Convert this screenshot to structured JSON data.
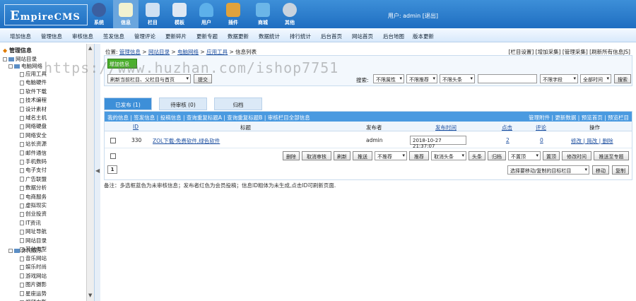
{
  "app": {
    "logo_main": "E",
    "logo_rest": "mpireCMS"
  },
  "topnav": [
    {
      "label": "系统",
      "icon": "system-icon",
      "color": "#3b5fa0"
    },
    {
      "label": "信息",
      "icon": "edit-icon",
      "color": "#f2f2d0"
    },
    {
      "label": "栏目",
      "icon": "column-icon",
      "color": "#cfe0f2"
    },
    {
      "label": "模板",
      "icon": "template-icon",
      "color": "#dfe8f3"
    },
    {
      "label": "用户",
      "icon": "user-icon",
      "color": "#5db0ea"
    },
    {
      "label": "插件",
      "icon": "plugin-icon",
      "color": "#e0a23c"
    },
    {
      "label": "商城",
      "icon": "shop-icon",
      "color": "#6bb6e8"
    },
    {
      "label": "其他",
      "icon": "gear-icon",
      "color": "#c9d3de"
    }
  ],
  "userinfo": "用户: admin  [退出]",
  "subnav": [
    "增加信息",
    "管理信息",
    "审核信息",
    "签发信息",
    "管理评论",
    "更新碎片",
    "更新专题",
    "数据更新",
    "数据统计",
    "排行统计",
    "后台首页",
    "网站首页",
    "后台地图",
    "版本更新"
  ],
  "sidebar": {
    "title": "管理信息",
    "root": "网站目录",
    "group1": "电脑网络",
    "group1_items": [
      "应用工具",
      "电脑硬件",
      "软件下载",
      "技术编程",
      "设计素材",
      "域名主机",
      "网络硬盘",
      "网络安全",
      "站长资源",
      "邮件通信",
      "手机数码",
      "电子支付",
      "广告联盟",
      "数据分析",
      "电商服务",
      "虚拟现实",
      "创业投资",
      "IT资讯",
      "网址导航",
      "网站目录",
      "其他类型"
    ],
    "group2": "休闲娱乐",
    "group2_items": [
      "音乐网站",
      "娱乐时尚",
      "游戏网站",
      "图片摄影",
      "星座运势",
      "视频电影"
    ]
  },
  "breadcrumb": {
    "prefix": "位置:",
    "items": [
      "管理信息",
      "网站目录",
      "电脑网络",
      "应用工具",
      "信息列表"
    ]
  },
  "toplinks": "[栏目设置] [增加采集] [管理采集] [刷新所有信息JS]",
  "panel": {
    "batch_button": "增加信息",
    "refresh_select": "刷新当前栏目、父栏目与首页",
    "submit": "提交",
    "search_label": "搜索:",
    "filter1": "不限属性",
    "filter2": "不限推荐",
    "filter3": "不限头条",
    "field_select": "不限字段",
    "time_select": "全部时间",
    "search_button": "搜索"
  },
  "tabs": [
    "已发布 (1)",
    "待审核 (0)",
    "归档"
  ],
  "list_subnav_left": "我的信息 | 签发信息 | 投稿信息 | 查询重复标题A | 查询重复标题B | 审核栏目全部信息",
  "list_subnav_right": "管理附件 | 更新数据 | 预览首页 | 预览栏目",
  "columns": {
    "id": "ID",
    "title": "标题",
    "publisher": "发布者",
    "time": "发布时间",
    "clicks": "点击",
    "comments": "评论",
    "ops": "操作"
  },
  "rows": [
    {
      "id": "330",
      "title": "ZOL下载-免费软件,绿色软件",
      "publisher": "admin",
      "time": "2018-10-27 21:37:07",
      "clicks": "2",
      "comments": "0",
      "ops": "修改 | 简改 | 删除"
    }
  ],
  "actions": [
    "删除",
    "取消审核",
    "刷新",
    "推送",
    "不推荐",
    "推荐",
    "取消头条",
    "头条",
    "归档",
    "不置顶",
    "置顶",
    "修改时间",
    "推送至专题"
  ],
  "pager": {
    "page": "1",
    "move_select": "选择要移动/复制的目标栏目",
    "move": "移动",
    "copy": "复制"
  },
  "note": "备注：多选框蓝色为未审核信息；发布者红色为会员投稿；信息ID粗体为未生成,点击ID可刷新页面.",
  "watermark": "https://www.huzhan.com/ishop7751"
}
